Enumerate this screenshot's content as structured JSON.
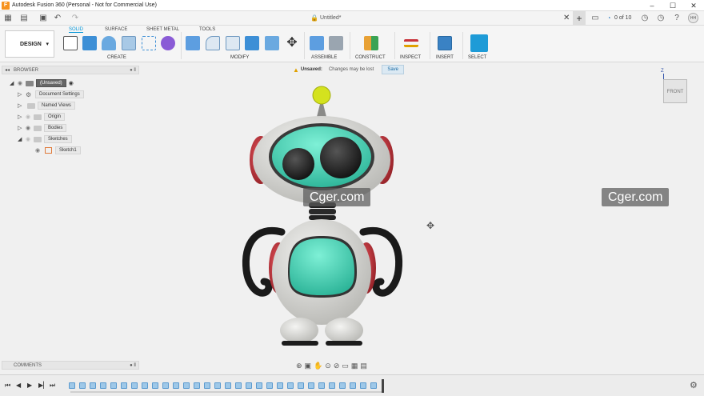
{
  "window": {
    "title": "Autodesk Fusion 360 (Personal - Not for Commercial Use)",
    "app_icon": "F",
    "controls": [
      "–",
      "☐",
      "✕"
    ]
  },
  "quick_access": {
    "doc_title": "Untitled*",
    "job_status": "0 of 10",
    "user_initials": "HH"
  },
  "toolbar": {
    "workspace": "DESIGN",
    "tabs": [
      "SOLID",
      "SURFACE",
      "SHEET METAL",
      "TOOLS"
    ],
    "active_tab": "SOLID",
    "groups": [
      "CREATE",
      "MODIFY",
      "ASSEMBLE",
      "CONSTRUCT",
      "INSPECT",
      "INSERT",
      "SELECT"
    ]
  },
  "browser": {
    "title": "BROWSER",
    "items": [
      {
        "label": "(Unsaved)"
      },
      {
        "label": "Document Settings"
      },
      {
        "label": "Named Views"
      },
      {
        "label": "Origin"
      },
      {
        "label": "Bodies"
      },
      {
        "label": "Sketches"
      },
      {
        "label": "Sketch1"
      }
    ]
  },
  "status_bar": {
    "label": "Unsaved:",
    "message": "Changes may be lost",
    "save_label": "Save"
  },
  "viewcube": {
    "face": "FRONT",
    "axis": "Z"
  },
  "watermarks": [
    "Cger.com",
    "Cger.com"
  ],
  "comments": {
    "title": "COMMENTS"
  },
  "colors": {
    "accent": "#0696d7",
    "robot_teal": "#3fd1b4",
    "robot_red": "#c8343b",
    "robot_body": "#e2e2de",
    "antenna": "#d4e21e"
  }
}
